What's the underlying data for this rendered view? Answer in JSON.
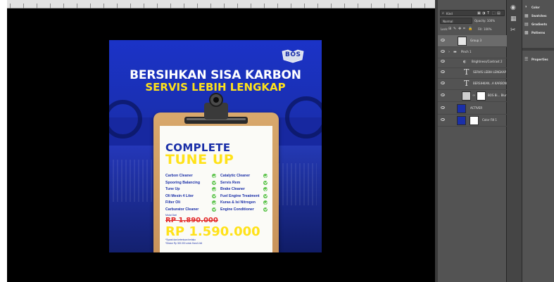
{
  "layers_panel": {
    "search_placeholder": "Kind",
    "blend_mode": "Normal",
    "opacity_label": "Opacity: 100%",
    "lock_label": "Lock:",
    "fill_label": "Fill: 100%",
    "layers": [
      {
        "name": "Group 3",
        "type": "group",
        "selected": true
      },
      {
        "name": "Pinch 1",
        "type": "folder"
      },
      {
        "name": "Brightness/Contrast 2",
        "type": "adjustment"
      },
      {
        "name": "SERVIS LEBIH LENGKAP",
        "type": "text"
      },
      {
        "name": "BERSIHKAN...A KARBON",
        "type": "text"
      },
      {
        "name": "BOS Bi... Blur",
        "type": "smart"
      },
      {
        "name": "ACTIVER",
        "type": "image"
      },
      {
        "name": "Color Fill 1",
        "type": "fill"
      }
    ]
  },
  "side_panel": {
    "items": [
      {
        "label": "Color",
        "icon": "color-icon"
      },
      {
        "label": "Swatches",
        "icon": "swatches-icon"
      },
      {
        "label": "Gradients",
        "icon": "gradients-icon"
      },
      {
        "label": "Patterns",
        "icon": "patterns-icon"
      },
      {
        "label": "Properties",
        "icon": "properties-icon"
      }
    ]
  },
  "poster": {
    "logo_text": "BOS",
    "headline_1": "BERSIHKAN SISA KARBON",
    "headline_2": "SERVIS LEBIH LENGKAP",
    "title_1": "COMPLETE",
    "title_2": "TUNE UP",
    "services_left": [
      "Carbon Cleaner",
      "Spooring Balancing",
      "Tune Up",
      "Oli Mesin 4 Liter",
      "Filter Oli",
      "Carburator Cleaner"
    ],
    "services_right": [
      "Catalytic Cleaner",
      "Servis Rem",
      "Brake Cleaner",
      "Fuel Engine Treatment",
      "Kuras & Isi Nitrogen",
      "Engine Conditioner"
    ],
    "price_prefix": "Mulai Dari",
    "old_price": "RP 1.890.000",
    "new_price": "RP 1.590.000",
    "footnote_1": "*Syarat dan ketentuan berlaku",
    "footnote_2": "*Diskon Rp 300.000 untuk Hand Unit"
  },
  "colors": {
    "poster_blue": "#1a2fa8",
    "poster_yellow": "#ffe21a",
    "price_red": "#e32b2b",
    "check_green": "#5cc34a",
    "panel_gray": "#535353"
  }
}
